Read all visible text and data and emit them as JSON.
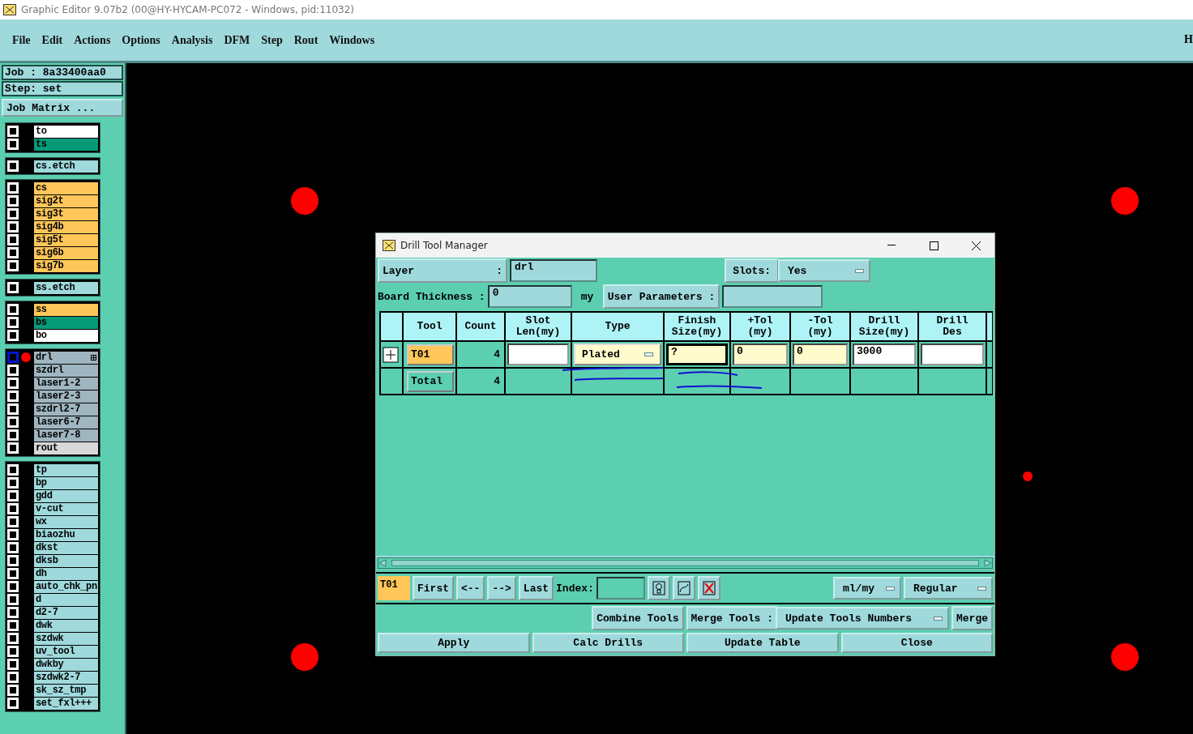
{
  "window": {
    "title": "Graphic Editor 9.07b2 (00@HY-HYCAM-PC072 - Windows, pid:11032)"
  },
  "menu": [
    "File",
    "Edit",
    "Actions",
    "Options",
    "Analysis",
    "DFM",
    "Step",
    "Rout",
    "Windows"
  ],
  "menu_cut": "H",
  "sidebar": {
    "job": "Job : 8a33400aa0",
    "step": "Step: set",
    "job_matrix_button": "Job Matrix ...",
    "layer_groups": [
      [
        {
          "name": "to",
          "color": "#ffffff",
          "active": false
        },
        {
          "name": "ts",
          "color": "#079a78",
          "active": false
        }
      ],
      [
        {
          "name": "cs.etch",
          "color": "#9fd9dc",
          "active": false
        }
      ],
      [
        {
          "name": "cs",
          "color": "#ffc65a",
          "active": false
        },
        {
          "name": "sig2t",
          "color": "#ffc65a",
          "active": false
        },
        {
          "name": "sig3t",
          "color": "#ffc65a",
          "active": false
        },
        {
          "name": "sig4b",
          "color": "#ffc65a",
          "active": false
        },
        {
          "name": "sig5t",
          "color": "#ffc65a",
          "active": false
        },
        {
          "name": "sig6b",
          "color": "#ffc65a",
          "active": false
        },
        {
          "name": "sig7b",
          "color": "#ffc65a",
          "active": false
        }
      ],
      [
        {
          "name": "ss.etch",
          "color": "#9fd9dc",
          "active": false
        }
      ],
      [
        {
          "name": "ss",
          "color": "#ffc65a",
          "active": false
        },
        {
          "name": "bs",
          "color": "#079a78",
          "active": false
        },
        {
          "name": "bo",
          "color": "#ffffff",
          "active": false
        }
      ],
      [
        {
          "name": "drl",
          "color": "#9fb6c0",
          "active": true
        },
        {
          "name": "szdrl",
          "color": "#9fb6c0",
          "active": false
        },
        {
          "name": "laser1-2",
          "color": "#9fb6c0",
          "active": false
        },
        {
          "name": "laser2-3",
          "color": "#9fb6c0",
          "active": false
        },
        {
          "name": "szdrl2-7",
          "color": "#9fb6c0",
          "active": false
        },
        {
          "name": "laser6-7",
          "color": "#9fb6c0",
          "active": false
        },
        {
          "name": "laser7-8",
          "color": "#9fb6c0",
          "active": false
        },
        {
          "name": "rout",
          "color": "#d8d8d8",
          "active": false
        }
      ],
      [
        {
          "name": "tp",
          "color": "#9fd9dc",
          "active": false
        },
        {
          "name": "bp",
          "color": "#9fd9dc",
          "active": false
        },
        {
          "name": "gdd",
          "color": "#9fd9dc",
          "active": false
        },
        {
          "name": "v-cut",
          "color": "#9fd9dc",
          "active": false
        },
        {
          "name": "wx",
          "color": "#9fd9dc",
          "active": false
        },
        {
          "name": "biaozhu",
          "color": "#9fd9dc",
          "active": false
        },
        {
          "name": "dkst",
          "color": "#9fd9dc",
          "active": false
        },
        {
          "name": "dksb",
          "color": "#9fd9dc",
          "active": false
        },
        {
          "name": "dh",
          "color": "#9fd9dc",
          "active": false
        },
        {
          "name": "auto_chk_pn",
          "color": "#9fd9dc",
          "active": false
        },
        {
          "name": "d",
          "color": "#9fd9dc",
          "active": false
        },
        {
          "name": "d2-7",
          "color": "#9fd9dc",
          "active": false
        },
        {
          "name": "dwk",
          "color": "#9fd9dc",
          "active": false
        },
        {
          "name": "szdwk",
          "color": "#9fd9dc",
          "active": false
        },
        {
          "name": "uv_tool",
          "color": "#9fd9dc",
          "active": false
        },
        {
          "name": "dwkby",
          "color": "#9fd9dc",
          "active": false
        },
        {
          "name": "szdwk2-7",
          "color": "#9fd9dc",
          "active": false
        },
        {
          "name": "sk_sz_tmp",
          "color": "#9fd9dc",
          "active": false
        },
        {
          "name": "set_fxl+++",
          "color": "#9fd9dc",
          "active": false
        }
      ]
    ]
  },
  "dialog": {
    "title": "Drill Tool Manager",
    "layer_label": "Layer",
    "layer_colon": ":",
    "layer_value": "drl",
    "slots_label": "Slots:",
    "slots_value": "Yes",
    "board_thickness_label": "Board Thickness :",
    "board_thickness_value": "0",
    "board_thickness_unit": "my",
    "user_parameters_button": "User Parameters :",
    "table": {
      "columns": [
        "Tool",
        "Count",
        "Slot Len(my)",
        "Type",
        "Finish Size(my)",
        "+Tol (my)",
        "-Tol (my)",
        "Drill Size(my)",
        "Drill Des"
      ],
      "rows": [
        {
          "cells": [
            {
              "kind": "button",
              "value": "T01",
              "color": "#ffc65a"
            },
            {
              "kind": "number",
              "value": "4"
            },
            {
              "kind": "field",
              "color": "#ffffff",
              "focused": false
            },
            {
              "kind": "dropdown",
              "value": "Plated",
              "color": "#fffbcc",
              "focused": false
            },
            {
              "kind": "field",
              "value": "?",
              "color": "#fffbcc",
              "focused": true
            },
            {
              "kind": "field",
              "value": "0",
              "color": "#fffbcc",
              "focused": false
            },
            {
              "kind": "field",
              "value": "0",
              "color": "#fffbcc",
              "focused": false
            },
            {
              "kind": "field",
              "value": "3000",
              "color": "#ffffff",
              "focused": false
            },
            {
              "kind": "field",
              "color": "#ffffff",
              "focused": false
            }
          ]
        },
        {
          "cells": [
            {
              "kind": "button",
              "value": "Total",
              "color": "#5ccfb1"
            },
            {
              "kind": "number",
              "value": "4"
            }
          ]
        }
      ]
    },
    "current_tool": "T01",
    "nav_buttons": [
      "First",
      "<--",
      "-->",
      "Last"
    ],
    "index_label": "Index:",
    "units": "ml/my",
    "mode": "Regular",
    "combine_button": "Combine Tools",
    "merge_label": "Merge Tools :",
    "merge_option": "Update Tools Numbers",
    "merge_button": "Merge",
    "actions": [
      "Apply",
      "Calc Drills",
      "Update Table",
      "Close"
    ]
  }
}
